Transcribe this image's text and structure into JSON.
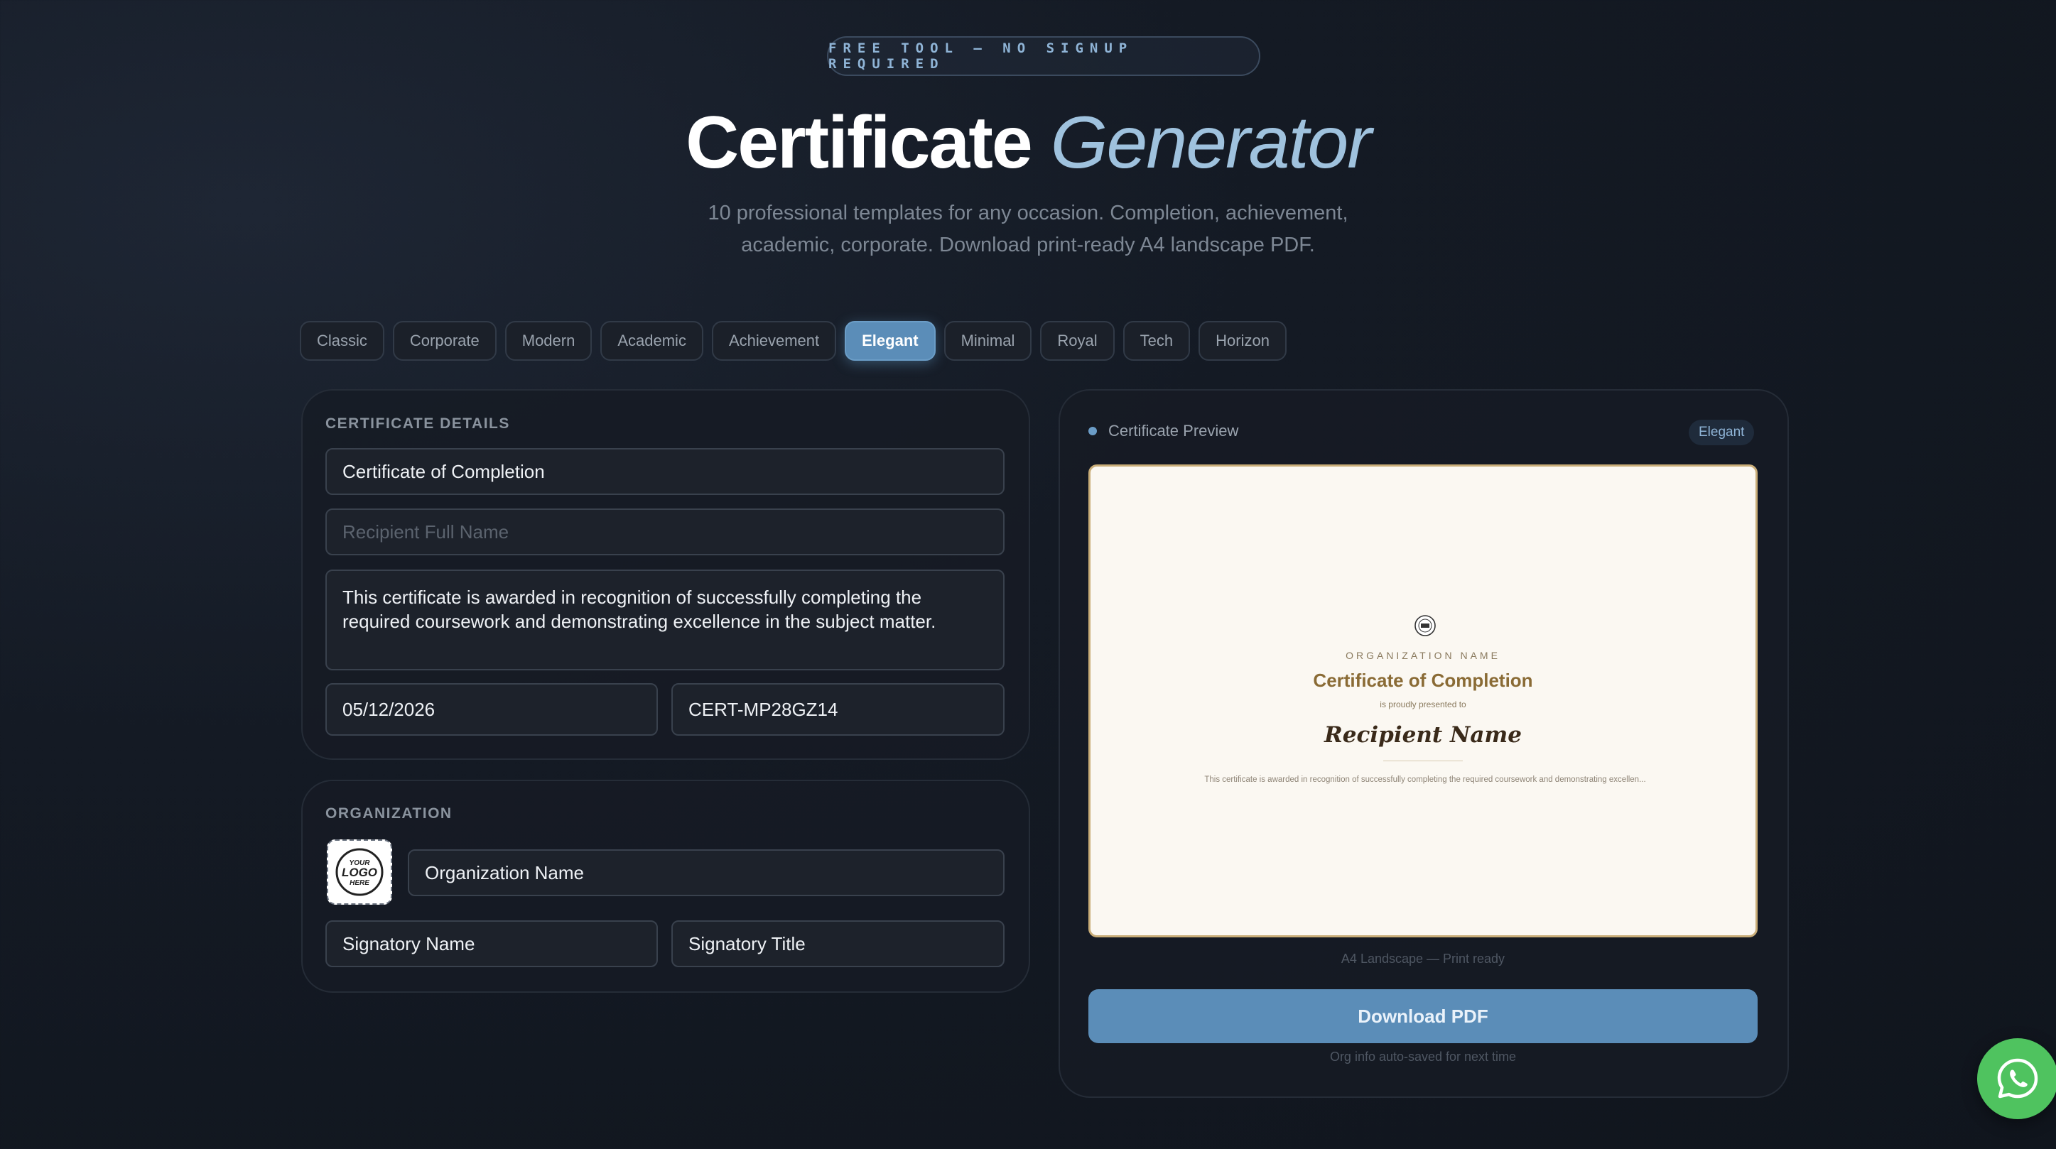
{
  "badge": "FREE TOOL — NO SIGNUP REQUIRED",
  "hero": {
    "title_strong": "Certificate",
    "title_italic": "Generator",
    "subtitle_line1": "10 professional templates for any occasion. Completion, achievement,",
    "subtitle_line2": "academic, corporate. Download print-ready A4 landscape PDF."
  },
  "templates": {
    "tabs": [
      "Classic",
      "Corporate",
      "Modern",
      "Academic",
      "Achievement",
      "Elegant",
      "Minimal",
      "Royal",
      "Tech",
      "Horizon"
    ],
    "selected": "Elegant"
  },
  "details": {
    "section_title": "CERTIFICATE DETAILS",
    "title_value": "Certificate of Completion",
    "recipient_placeholder": "Recipient Full Name",
    "description_value": "This certificate is awarded in recognition of successfully completing the required coursework and demonstrating excellence in the subject matter.",
    "date_value": "05/12/2026",
    "cert_id_value": "CERT-MP28GZ14"
  },
  "organization": {
    "section_title": "ORGANIZATION",
    "logo_text": "YOUR LOGO HERE",
    "org_name_value": "Organization Name",
    "signatory_name_value": "Signatory Name",
    "signatory_title_value": "Signatory Title"
  },
  "preview": {
    "header": "Certificate Preview",
    "template_badge": "Elegant",
    "org_name": "ORGANIZATION NAME",
    "cert_title": "Certificate of Completion",
    "presented_to": "is proudly presented to",
    "recipient": "Recipient Name",
    "description": "This certificate is awarded in recognition of successfully completing the required coursework and demonstrating excellen...",
    "caption": "A4 Landscape — Print ready"
  },
  "download": {
    "label": "Download PDF",
    "note": "Org info auto-saved for next time"
  },
  "colors": {
    "accent": "#5b8db8",
    "background": "#141a24",
    "certificate_gold": "#8a6b35",
    "whatsapp": "#4fc35f"
  },
  "icons": {
    "whatsapp": "whatsapp-icon",
    "logo_placeholder": "logo-placeholder-icon"
  }
}
